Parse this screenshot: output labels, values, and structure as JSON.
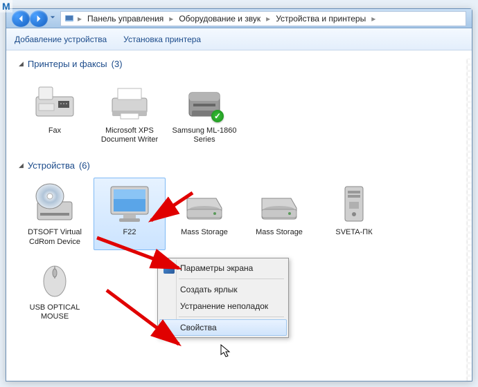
{
  "page_marker": "M",
  "breadcrumb": {
    "items": [
      "Панель управления",
      "Оборудование и звук",
      "Устройства и принтеры"
    ]
  },
  "toolbar": {
    "add_device": "Добавление устройства",
    "install_printer": "Установка принтера"
  },
  "groups": {
    "printers": {
      "title": "Принтеры и факсы",
      "count": "(3)",
      "items": [
        {
          "label": "Fax",
          "icon": "fax"
        },
        {
          "label": "Microsoft XPS Document Writer",
          "icon": "printer"
        },
        {
          "label": "Samsung ML-1860 Series",
          "icon": "printer-laser",
          "default": true
        }
      ]
    },
    "devices": {
      "title": "Устройства",
      "count": "(6)",
      "items": [
        {
          "label": "DTSOFT Virtual CdRom Device",
          "icon": "cdrom"
        },
        {
          "label": "F22",
          "icon": "monitor",
          "selected": true
        },
        {
          "label": "Mass Storage",
          "icon": "hdd"
        },
        {
          "label": "Mass Storage",
          "icon": "hdd"
        },
        {
          "label": "SVETA-ПК",
          "icon": "pc"
        },
        {
          "label": "USB OPTICAL MOUSE",
          "icon": "mouse"
        }
      ]
    }
  },
  "context_menu": {
    "display_settings": "Параметры экрана",
    "create_shortcut": "Создать ярлык",
    "troubleshoot": "Устранение неполадок",
    "properties": "Свойства"
  }
}
